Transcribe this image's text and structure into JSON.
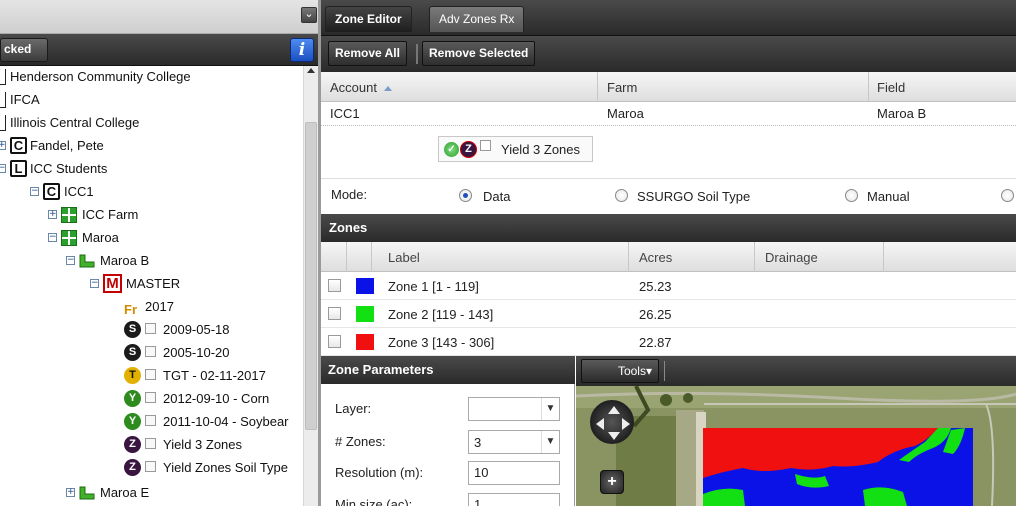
{
  "left_panel": {
    "header_text": "cked",
    "info_icon_glyph": "i",
    "collapse_glyph": "⌄",
    "tree": [
      {
        "label": "Henderson Community College",
        "icon": "none"
      },
      {
        "label": "IFCA",
        "icon": "none"
      },
      {
        "label": "Illinois Central College",
        "icon": "none"
      },
      {
        "label": "Fandel, Pete",
        "icon": "client-C"
      },
      {
        "label": "ICC Students",
        "icon": "client-L"
      },
      {
        "label": "ICC1",
        "icon": "client-C"
      },
      {
        "label": "ICC Farm",
        "icon": "farm"
      },
      {
        "label": "Maroa",
        "icon": "farm"
      },
      {
        "label": "Maroa B",
        "icon": "field"
      },
      {
        "label": "MASTER",
        "icon": "master-M"
      },
      {
        "label": "2017",
        "icon": "Fr"
      },
      {
        "label": "2009-05-18",
        "icon": "S"
      },
      {
        "label": "2005-10-20",
        "icon": "S"
      },
      {
        "label": "TGT - 02-11-2017",
        "icon": "T"
      },
      {
        "label": "2012-09-10 - Corn",
        "icon": "Y"
      },
      {
        "label": "2011-10-04 - Soybear",
        "icon": "Y"
      },
      {
        "label": "Yield 3 Zones",
        "icon": "Z"
      },
      {
        "label": "Yield Zones Soil Type",
        "icon": "Z"
      },
      {
        "label": "Maroa E",
        "icon": "field"
      }
    ],
    "icon_letters": {
      "C": "C",
      "L": "L",
      "M": "M",
      "Fr": "Fr",
      "S": "S",
      "T": "T",
      "Y": "Y",
      "Z": "Z"
    }
  },
  "tabs": [
    {
      "label": "Zone Editor",
      "active": true
    },
    {
      "label": "Adv Zones Rx",
      "active": false
    }
  ],
  "toolbar": {
    "remove_all": "Remove All",
    "remove_selected": "Remove Selected"
  },
  "grid": {
    "headers": [
      "Account",
      "Farm",
      "Field"
    ],
    "row": [
      "ICC1",
      "Maroa",
      "Maroa B"
    ]
  },
  "zone_layer": {
    "badge_letter": "Z",
    "label": "Yield 3 Zones"
  },
  "mode": {
    "label": "Mode:",
    "options": [
      "Data",
      "SSURGO Soil Type",
      "Manual"
    ],
    "selected": "Data"
  },
  "zones": {
    "title": "Zones",
    "headers": [
      "Label",
      "Acres",
      "Drainage"
    ],
    "rows": [
      {
        "label": "Zone 1 [1 - 119]",
        "acres": "25.23",
        "color": "#0a12e8"
      },
      {
        "label": "Zone 2 [119 - 143]",
        "acres": "26.25",
        "color": "#12e012"
      },
      {
        "label": "Zone 3 [143 - 306]",
        "acres": "22.87",
        "color": "#f01010"
      }
    ]
  },
  "zone_parameters": {
    "title": "Zone Parameters",
    "layer_label": "Layer:",
    "layer_value": "",
    "zones_label": "# Zones:",
    "zones_value": "3",
    "resolution_label": "Resolution (m):",
    "resolution_value": "10",
    "minsize_label": "Min size (ac):",
    "minsize_value": "1"
  },
  "map": {
    "tools_label": "Tools",
    "tools_arrow": "▾"
  },
  "colors": {
    "zone_red": "#f01010",
    "zone_green": "#12e012",
    "zone_blue": "#0a12e8",
    "master_red": "#c40000"
  }
}
